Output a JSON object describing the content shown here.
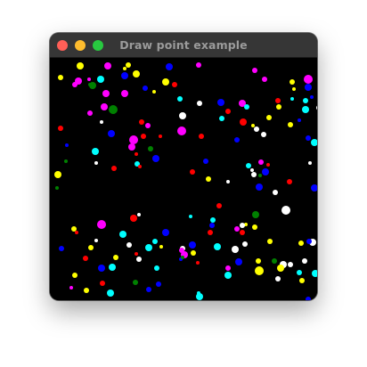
{
  "window": {
    "title": "Draw point example",
    "controls": {
      "close_color": "#ff5f57",
      "minimize_color": "#febc2e",
      "zoom_color": "#28c840"
    }
  },
  "canvas": {
    "background": "#000000",
    "point_colors": [
      "#ffffff",
      "#ffff00",
      "#ff00ff",
      "#00ffff",
      "#0000ff",
      "#ff0000",
      "#008000"
    ]
  }
}
